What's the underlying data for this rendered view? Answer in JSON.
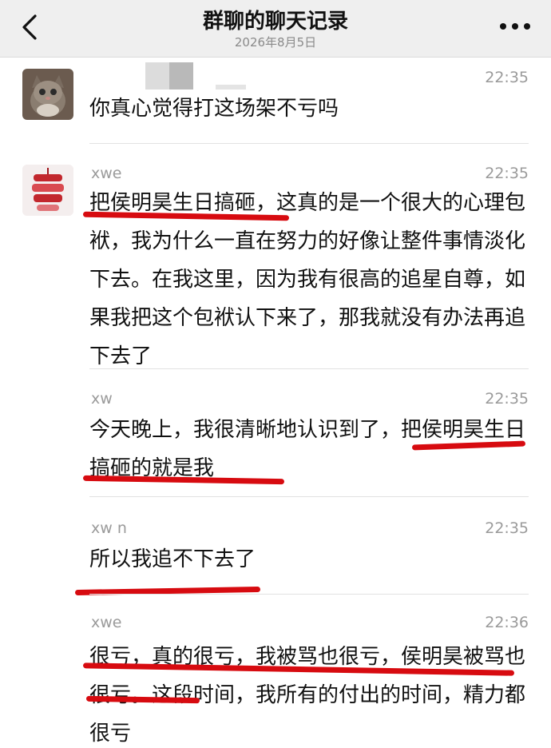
{
  "header": {
    "title": "群聊的聊天记录",
    "subtitle": "2026年8月5日",
    "back_icon": "chevron-left-icon",
    "more_icon": "more-dots-icon"
  },
  "messages": [
    {
      "sender": "",
      "time": "22:35",
      "text": "你真心觉得打这场架不亏吗",
      "avatar": "kitten-avatar"
    },
    {
      "sender": "xwe",
      "time": "22:35",
      "text": "把侯明昊生日搞砸，这真的是一个很大的心理包袱，我为什么一直在努力的好像让整件事情淡化下去。在我这里，因为我有很高的追星自尊，如果我把这个包袱认下来了，那我就没有办法再追下去了",
      "avatar": "stacked-cake-avatar"
    },
    {
      "sender": "xw",
      "time": "22:35",
      "text": "今天晚上，我很清晰地认识到了，把侯明昊生日搞砸的就是我"
    },
    {
      "sender": "xw n",
      "time": "22:35",
      "text": "所以我追不下去了"
    },
    {
      "sender": "xwe",
      "time": "22:36",
      "text": "很亏，真的很亏，我被骂也很亏，侯明昊被骂也很亏。这段时间，我所有的付出的时间，精力都很亏"
    }
  ],
  "colors": {
    "header_bg": "#efefef",
    "annotation_red": "#d70b10",
    "meta_gray": "#9a9a9a"
  }
}
